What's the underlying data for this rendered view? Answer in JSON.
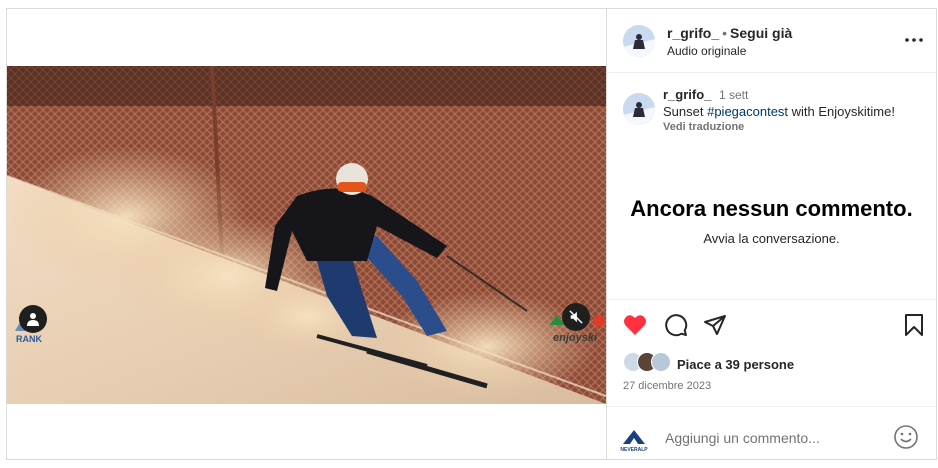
{
  "header": {
    "username": "r_grifo_",
    "separator": "•",
    "follow_label": "Segui già",
    "audio_label": "Audio originale",
    "more_icon": "more-horizontal-icon"
  },
  "caption": {
    "username": "r_grifo_",
    "time": "1 sett",
    "text_before": "Sunset ",
    "hashtag": "#piegacontest",
    "text_after": " with Enjoyskitime!",
    "translate_label": "Vedi traduzione"
  },
  "comments": {
    "empty_title": "Ancora nessun commento.",
    "empty_subtitle": "Avvia la conversazione."
  },
  "actions": {
    "liked": true,
    "like_color": "#ff3040",
    "likes_text": "Piace a 39 persone",
    "date": "27 dicembre 2023"
  },
  "comment_box": {
    "placeholder": "Aggiungi un commento...",
    "avatar_text": "NEVERALP"
  },
  "media": {
    "watermark_left": "RANK",
    "watermark_right": "enjoyski"
  }
}
